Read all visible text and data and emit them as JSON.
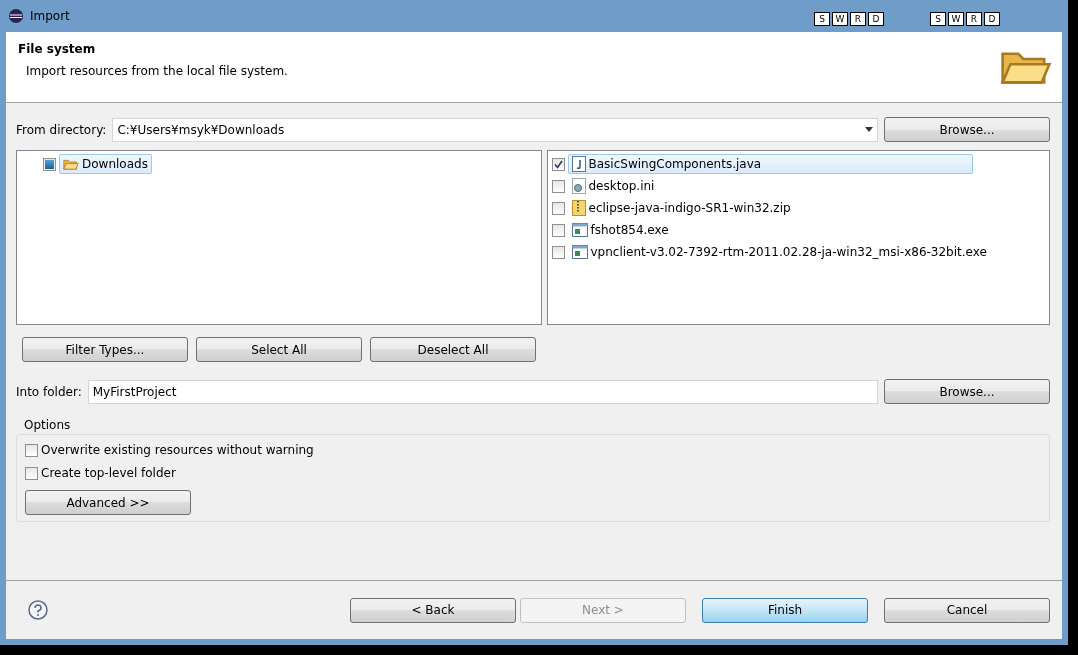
{
  "window": {
    "title": "Import"
  },
  "overlay_keys": [
    [
      "S",
      "W",
      "R",
      "D"
    ],
    [
      "S",
      "W",
      "R",
      "D"
    ]
  ],
  "header": {
    "title": "File system",
    "description": "Import resources from the local file system."
  },
  "from_directory": {
    "label": "From directory:",
    "value": "C:¥Users¥msyk¥Downloads",
    "browse": "Browse..."
  },
  "folder_tree": [
    {
      "label": "Downloads",
      "checked": true,
      "grayed": true,
      "selected": true
    }
  ],
  "files": [
    {
      "name": "BasicSwingComponents.java",
      "kind": "java",
      "checked": true,
      "selected": true
    },
    {
      "name": "desktop.ini",
      "kind": "ini",
      "checked": false,
      "selected": false
    },
    {
      "name": "eclipse-java-indigo-SR1-win32.zip",
      "kind": "zip",
      "checked": false,
      "selected": false
    },
    {
      "name": "fshot854.exe",
      "kind": "exe",
      "checked": false,
      "selected": false
    },
    {
      "name": "vpnclient-v3.02-7392-rtm-2011.02.28-ja-win32_msi-x86-32bit.exe",
      "kind": "exe",
      "checked": false,
      "selected": false
    }
  ],
  "selection_buttons": [
    "Filter Types...",
    "Select All",
    "Deselect All"
  ],
  "into_folder": {
    "label": "Into folder:",
    "value": "MyFirstProject",
    "browse": "Browse..."
  },
  "options": {
    "title": "Options",
    "checkboxes": [
      {
        "label": "Overwrite existing resources without warning",
        "checked": false
      },
      {
        "label": "Create top-level folder",
        "checked": false
      }
    ],
    "advanced": "Advanced >>"
  },
  "footer_buttons": [
    {
      "label": "< Back",
      "disabled": false,
      "default": false
    },
    {
      "label": "Next >",
      "disabled": true,
      "default": false
    },
    {
      "label": "Finish",
      "disabled": false,
      "default": true
    },
    {
      "label": "Cancel",
      "disabled": false,
      "default": false
    }
  ]
}
